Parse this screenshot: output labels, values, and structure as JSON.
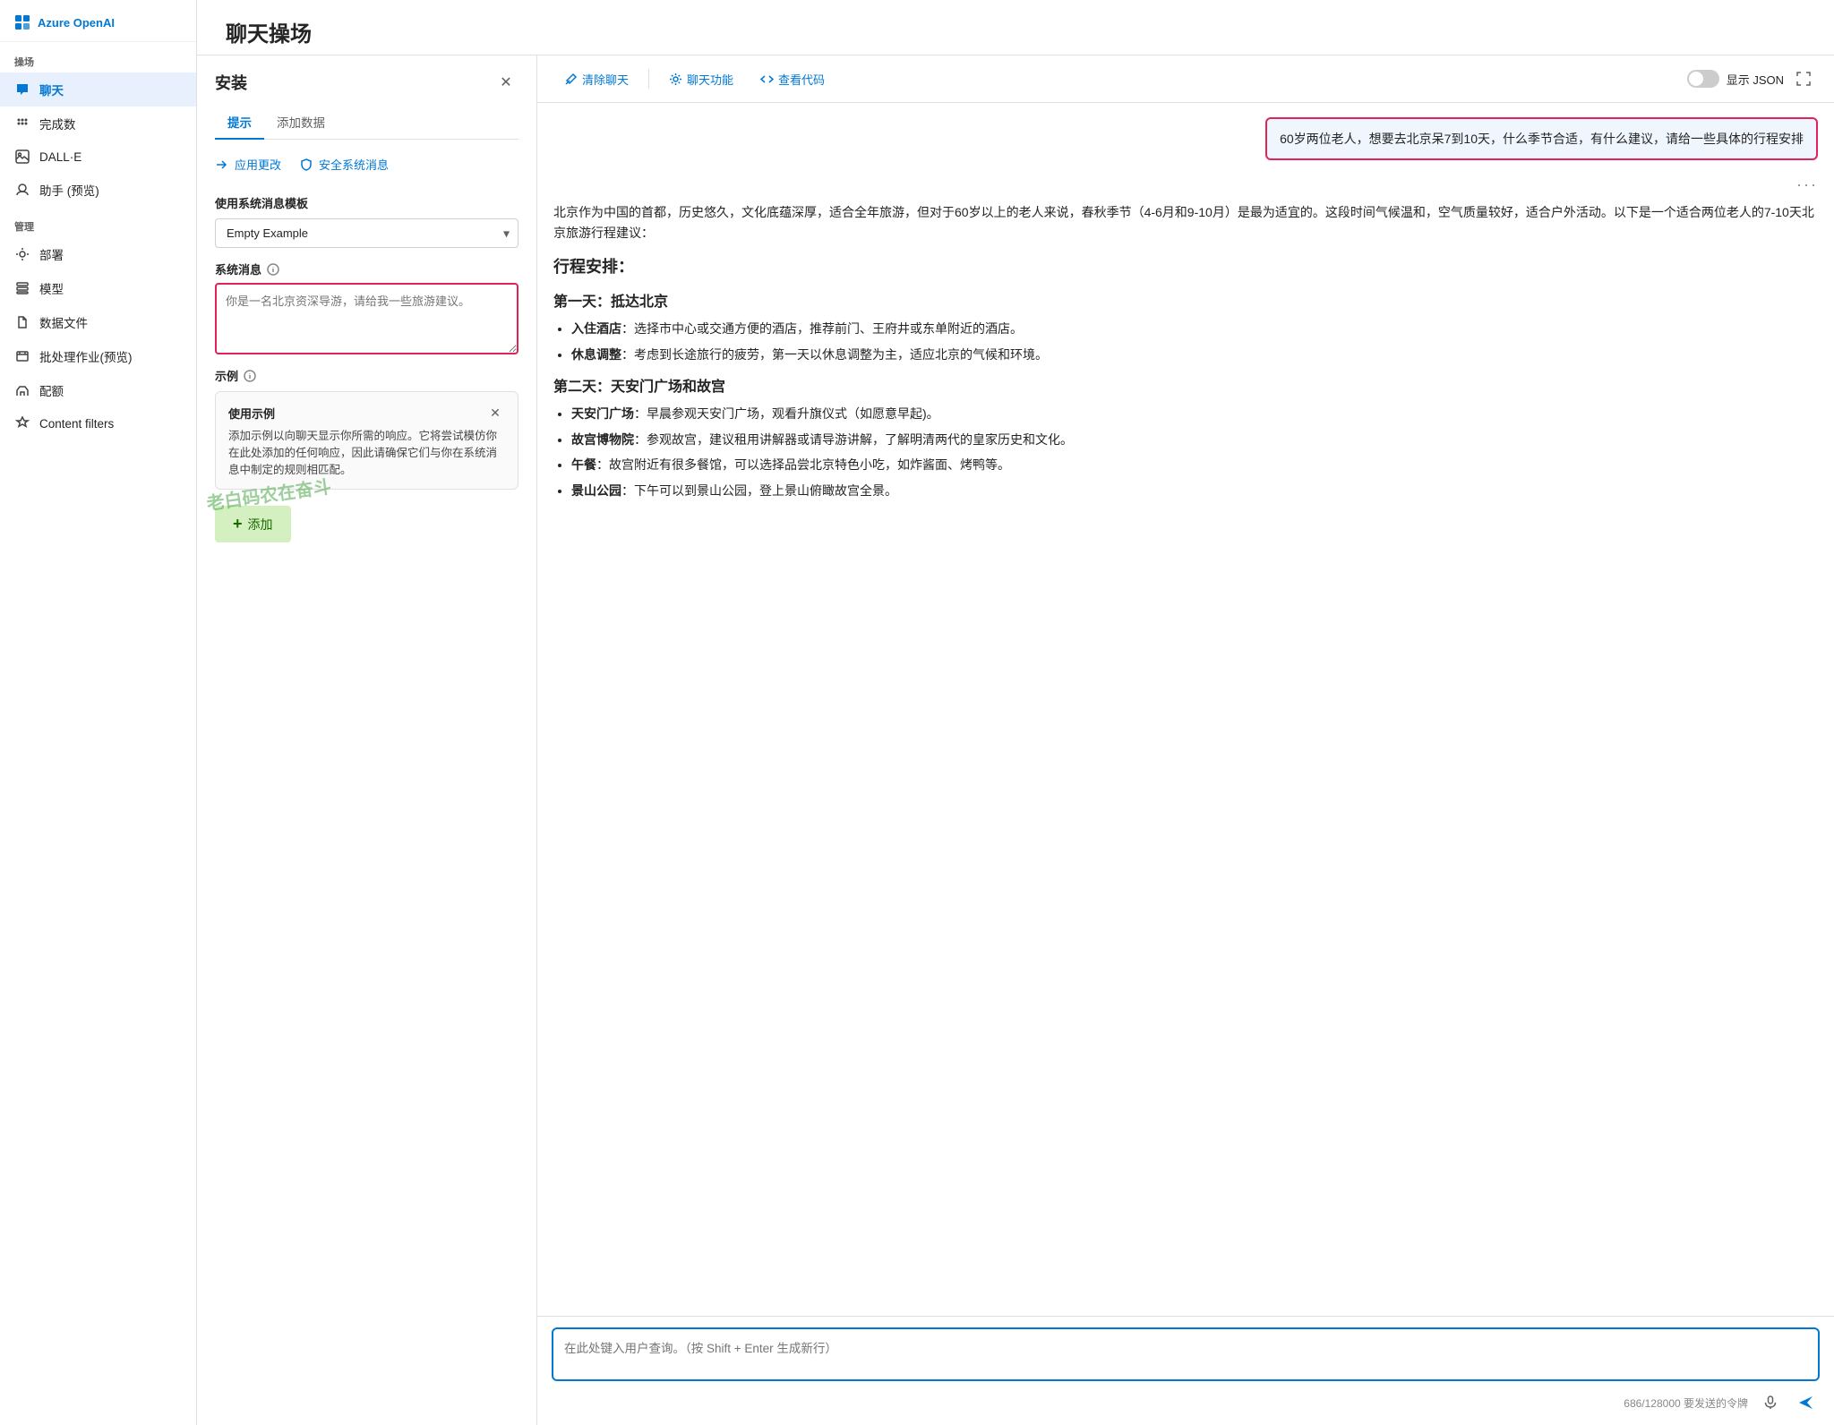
{
  "sidebar": {
    "logo": "Azure OpenAI",
    "sections": [
      {
        "label": "操场",
        "items": [
          {
            "id": "chat",
            "label": "聊天",
            "active": true
          },
          {
            "id": "completions",
            "label": "完成数",
            "active": false
          },
          {
            "id": "dalle",
            "label": "DALL·E",
            "active": false
          },
          {
            "id": "assistant",
            "label": "助手 (预览)",
            "active": false
          }
        ]
      },
      {
        "label": "管理",
        "items": [
          {
            "id": "deployment",
            "label": "部署",
            "active": false
          },
          {
            "id": "models",
            "label": "模型",
            "active": false
          },
          {
            "id": "datafiles",
            "label": "数据文件",
            "active": false
          },
          {
            "id": "batch",
            "label": "批处理作业(预览)",
            "active": false
          },
          {
            "id": "quota",
            "label": "配额",
            "active": false
          },
          {
            "id": "content-filters",
            "label": "Content filters",
            "active": false
          }
        ]
      }
    ]
  },
  "page_title": "聊天操场",
  "setup": {
    "title": "安装",
    "tabs": [
      "提示",
      "添加数据"
    ],
    "active_tab": "提示",
    "sub_tabs": [
      "应用更改",
      "安全系统消息"
    ],
    "use_system_msg_label": "使用系统消息模板",
    "dropdown_value": "Empty Example",
    "system_msg_label": "系统消息",
    "system_msg_placeholder": "你是一名北京资深导游，请给我一些旅游建议。",
    "examples_label": "示例",
    "example_card_title": "使用示例",
    "example_card_text": "添加示例以向聊天显示你所需的响应。它将尝试模仿你在此处添加的任何响应，因此请确保它们与你在系统消息中制定的规则相匹配。",
    "add_btn_label": "添加"
  },
  "toolbar": {
    "clear_chat_label": "清除聊天",
    "chat_functions_label": "聊天功能",
    "view_code_label": "查看代码",
    "show_json_label": "显示 JSON",
    "toggle_on": false
  },
  "chat": {
    "user_message": "60岁两位老人，想要去北京呆7到10天，什么季节合适，有什么建议，请给一些具体的行程安排",
    "ai_intro": "北京作为中国的首都，历史悠久，文化底蕴深厚，适合全年旅游，但对于60岁以上的老人来说，春秋季节（4-6月和9-10月）是最为适宜的。这段时间气候温和，空气质量较好，适合户外活动。以下是一个适合两位老人的7-10天北京旅游行程建议：",
    "section_itinerary": "行程安排：",
    "day1_title": "第一天：抵达北京",
    "day1_items": [
      {
        "label": "入住酒店",
        "text": "选择市中心或交通方便的酒店，推荐前门、王府井或东单附近的酒店。"
      },
      {
        "label": "休息调整",
        "text": "考虑到长途旅行的疲劳，第一天以休息调整为主，适应北京的气候和环境。"
      }
    ],
    "day2_title": "第二天：天安门广场和故宫",
    "day2_items": [
      {
        "label": "天安门广场",
        "text": "早晨参观天安门广场，观看升旗仪式（如愿意早起)。"
      },
      {
        "label": "故宫博物院",
        "text": "参观故宫，建议租用讲解器或请导游讲解，了解明清两代的皇家历史和文化。"
      },
      {
        "label": "午餐",
        "text": "故宫附近有很多餐馆，可以选择品尝北京特色小吃，如炸酱面、烤鸭等。"
      },
      {
        "label": "景山公园",
        "text": "下午可以到景山公园，登上景山俯瞰故宫全景。"
      }
    ],
    "input_placeholder": "在此处键入用户查询。（按 Shift + Enter 生成新行）",
    "token_info": "686/128000 要发送的令牌"
  },
  "watermark": "老白码农在奋斗",
  "icons": {
    "logo": "⊞",
    "chat_icon": "💬",
    "completions_icon": "⠿",
    "dalle_icon": "🖼",
    "assistant_icon": "🤖",
    "deployment_icon": "⚙",
    "models_icon": "📦",
    "datafiles_icon": "📄",
    "batch_icon": "📋",
    "quota_icon": "📊",
    "content_filters_icon": "🔒",
    "close_icon": "✕",
    "chevron_down": "▾",
    "info_icon": "ⓘ",
    "shield_icon": "🛡",
    "gear_icon": "⚙",
    "code_icon": "◫",
    "send_icon": "➤",
    "mic_icon": "🎤",
    "more_icon": "···",
    "broom_icon": "🧹",
    "plus_icon": "+"
  }
}
